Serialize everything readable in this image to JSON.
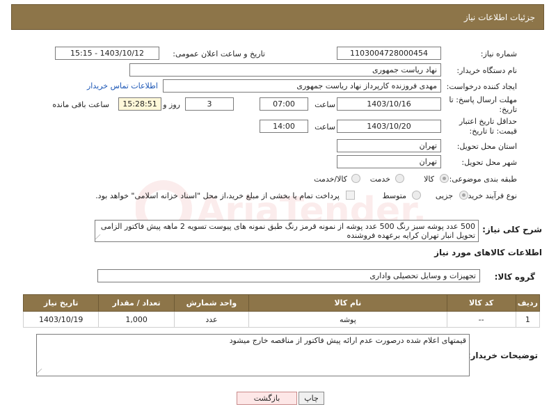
{
  "header": {
    "title": "جزئیات اطلاعات نیاز"
  },
  "form": {
    "need_number": {
      "label": "شماره نیاز:",
      "value": "1103004728000454"
    },
    "announce_datetime": {
      "label": "تاریخ و ساعت اعلان عمومی:",
      "value": "1403/10/12 - 15:15"
    },
    "buyer_org": {
      "label": "نام دستگاه خریدار:",
      "value": "نهاد ریاست جمهوری"
    },
    "requester": {
      "label": "ایجاد کننده درخواست:",
      "value": "مهدی فروزنده کارپرداز نهاد ریاست جمهوری",
      "contact_link": "اطلاعات تماس خریدار"
    },
    "reply_deadline": {
      "label": "مهلت ارسال پاسخ: تا تاریخ:",
      "date": "1403/10/16",
      "time_label": "ساعت",
      "time": "07:00",
      "days": "3",
      "days_label": "روز و",
      "remaining": "15:28:51",
      "remaining_label": "ساعت باقی مانده"
    },
    "price_validity": {
      "label": "حداقل تاریخ اعتبار قیمت: تا تاریخ:",
      "date": "1403/10/20",
      "time_label": "ساعت",
      "time": "14:00"
    },
    "delivery_province": {
      "label": "استان محل تحویل:",
      "value": "تهران"
    },
    "delivery_city": {
      "label": "شهر محل تحویل:",
      "value": "تهران"
    },
    "category": {
      "label": "طبقه بندی موضوعی:",
      "options": [
        "کالا",
        "خدمت",
        "کالا/خدمت"
      ],
      "selected": "کالا"
    },
    "purchase_process": {
      "label": "نوع فرآیند خرید :",
      "options": [
        "جزیی",
        "متوسط"
      ],
      "selected": "جزیی",
      "treasury_note": "پرداخت تمام یا بخشی از مبلغ خرید،از محل \"اسناد خزانه اسلامی\" خواهد بود."
    },
    "description": {
      "label": "شرح کلی نیاز:",
      "value": "500 عدد پوشه سبز رنگ 500 عدد پوشه از نمونه قرمز رنگ طبق نمونه های پیوست تسویه 2 ماهه پیش فاکتور الزامی تحویل انبار تهران کرایه برعهده فروشنده"
    }
  },
  "goods_section": {
    "title": "اطلاعات کالاهای مورد نیاز",
    "group_label": "گروه کالا:",
    "group_value": "تجهیزات و وسایل تحصیلی واداری",
    "columns": [
      "ردیف",
      "کد کالا",
      "نام کالا",
      "واحد شمارش",
      "تعداد / مقدار",
      "تاریخ نیاز"
    ],
    "rows": [
      [
        "1",
        "--",
        "پوشه",
        "عدد",
        "1,000",
        "1403/10/19"
      ]
    ]
  },
  "buyer_notes": {
    "label": "توضیحات خریدار:",
    "value": "قیمتهای اعلام شده درصورت عدم ارائه پیش فاکتور از مناقصه خارج میشود"
  },
  "buttons": {
    "print": "چاپ",
    "back": "بازگشت"
  },
  "watermark": {
    "text": "AriaTender.net"
  }
}
